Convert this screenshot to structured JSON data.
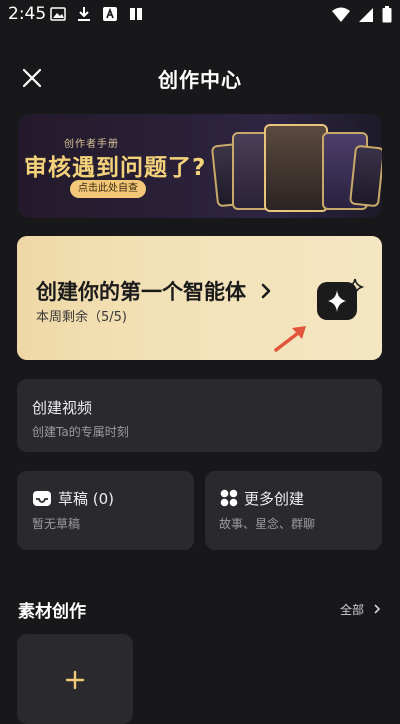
{
  "status": {
    "time": "2:45"
  },
  "header": {
    "title": "创作中心"
  },
  "banner": {
    "subtitle": "创作者手册",
    "title": "审核遇到问题了?",
    "cta": "点击此处自查"
  },
  "agent_card": {
    "title": "创建你的第一个智能体",
    "remaining": "本周剩余（5/5)"
  },
  "video_card": {
    "title": "创建视频",
    "subtitle": "创建Ta的专属时刻"
  },
  "draft_card": {
    "title": "草稿 (0)",
    "subtitle": "暂无草稿"
  },
  "more_card": {
    "title": "更多创建",
    "subtitle": "故事、星念、群聊"
  },
  "materials": {
    "title": "素材创作",
    "see_all": "全部"
  },
  "colors": {
    "background": "#18181b",
    "panel": "#2a2a2e",
    "gold_accent": "#f2c878",
    "arrow": "#e2553a"
  }
}
